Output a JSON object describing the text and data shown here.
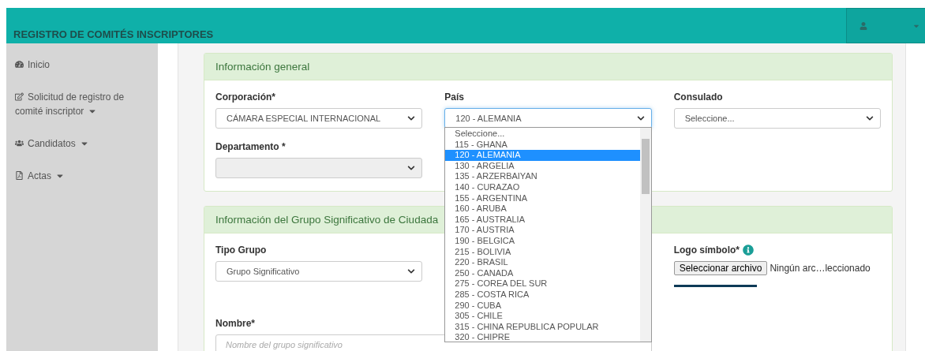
{
  "header": {
    "title": "REGISTRO DE COMITÉS INSCRIPTORES"
  },
  "sidebar": {
    "items": [
      {
        "label": "Inicio",
        "kind": "home",
        "has_submenu": false
      },
      {
        "label": "Solicitud de registro de comité inscriptor",
        "kind": "form",
        "has_submenu": true
      },
      {
        "label": "Candidatos",
        "kind": "people",
        "has_submenu": true
      },
      {
        "label": "Actas",
        "kind": "document",
        "has_submenu": true
      }
    ]
  },
  "panels": [
    {
      "title": "Información general",
      "fields": [
        {
          "kind": "select",
          "label": "Corporación*",
          "value": "CÁMARA ESPECIAL INTERNACIONAL",
          "disabled": false
        },
        {
          "kind": "select",
          "label": "País",
          "value": "120 - ALEMANIA",
          "disabled": false,
          "focused": true,
          "open": true,
          "options": [
            {
              "label": "Seleccione...",
              "selected": false
            },
            {
              "label": "115 - GHANA",
              "selected": false
            },
            {
              "label": "120 - ALEMANIA",
              "selected": true
            },
            {
              "label": "130 - ARGELIA",
              "selected": false
            },
            {
              "label": "135 - ARZERBAIYAN",
              "selected": false
            },
            {
              "label": "140 - CURAZAO",
              "selected": false
            },
            {
              "label": "155 - ARGENTINA",
              "selected": false
            },
            {
              "label": "160 - ARUBA",
              "selected": false
            },
            {
              "label": "165 - AUSTRALIA",
              "selected": false
            },
            {
              "label": "170 - AUSTRIA",
              "selected": false
            },
            {
              "label": "190 - BELGICA",
              "selected": false
            },
            {
              "label": "215 - BOLIVIA",
              "selected": false
            },
            {
              "label": "220 - BRASIL",
              "selected": false
            },
            {
              "label": "250 - CANADA",
              "selected": false
            },
            {
              "label": "275 - COREA DEL SUR",
              "selected": false
            },
            {
              "label": "285 - COSTA RICA",
              "selected": false
            },
            {
              "label": "290 - CUBA",
              "selected": false
            },
            {
              "label": "305 - CHILE",
              "selected": false
            },
            {
              "label": "315 - CHINA REPUBLICA POPULAR",
              "selected": false
            },
            {
              "label": "320 - CHIPRE",
              "selected": false
            }
          ]
        },
        {
          "kind": "select",
          "label": "Consulado",
          "placeholder": "Seleccione...",
          "disabled": false
        },
        {
          "kind": "select",
          "label": "Departamento *",
          "disabled": true
        }
      ]
    },
    {
      "title": "Información del Grupo Significativo de Ciudada",
      "fields": [
        {
          "kind": "select",
          "label": "Tipo Grupo",
          "value": "Grupo Significativo",
          "disabled": false
        },
        {
          "kind": "empty"
        },
        {
          "kind": "file",
          "label": "Logo símbolo*",
          "info": true,
          "button": "Seleccionar archivo",
          "status": "Ningún arc…leccionado"
        },
        {
          "kind": "text",
          "label": "Nombre*",
          "placeholder": "Nombre del grupo significativo"
        }
      ]
    }
  ]
}
